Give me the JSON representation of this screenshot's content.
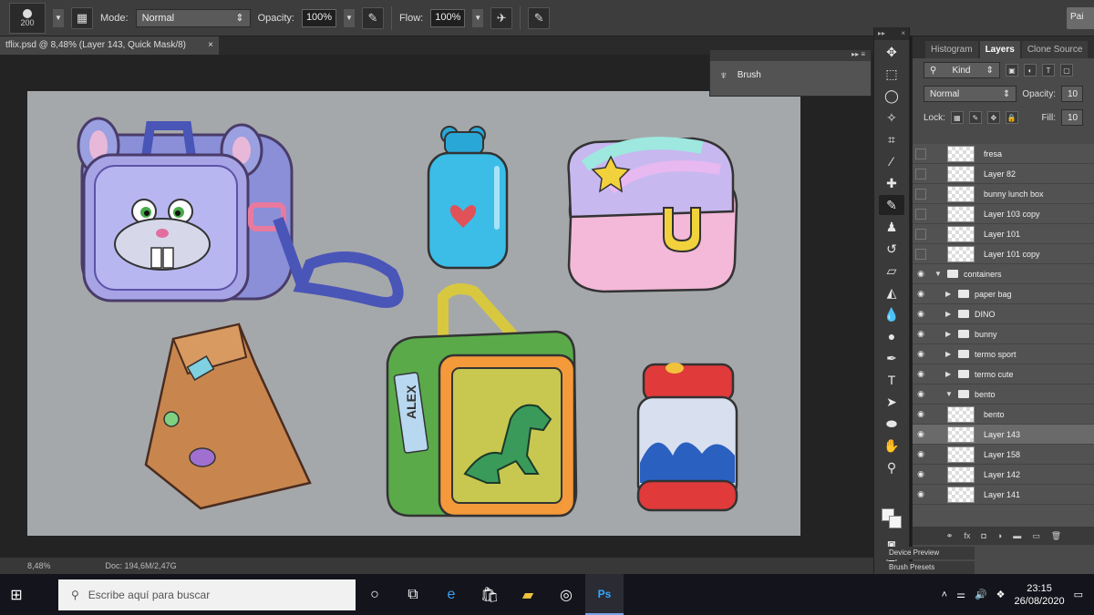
{
  "options_bar": {
    "brush_size": "200",
    "mode_label": "Mode:",
    "mode_value": "Normal",
    "opacity_label": "Opacity:",
    "opacity_value": "100%",
    "flow_label": "Flow:",
    "flow_value": "100%",
    "right_button": "Pai"
  },
  "document": {
    "tab_title": "tflix.psd @ 8,48% (Layer 143, Quick Mask/8)",
    "tab_close": "×",
    "zoom": "8,48%",
    "doc_size": "Doc: 194,6M/2,47G"
  },
  "canvas_art": {
    "lunchbox_name": "ALEX"
  },
  "brush_panel": {
    "label": "Brush"
  },
  "panels": {
    "tabs": [
      "Histogram",
      "Layers",
      "Clone Source"
    ],
    "active_tab": "Layers",
    "filter_kind": "Kind",
    "blend_mode": "Normal",
    "opacity_label": "Opacity:",
    "opacity_value": "10",
    "lock_label": "Lock:",
    "fill_label": "Fill:",
    "fill_value": "10",
    "layers": [
      {
        "name": "fresa",
        "type": "layer",
        "visible": false
      },
      {
        "name": "Layer 82",
        "type": "layer",
        "visible": false
      },
      {
        "name": "bunny lunch box",
        "type": "layer",
        "visible": false
      },
      {
        "name": "Layer 103 copy",
        "type": "layer",
        "visible": false
      },
      {
        "name": "Layer 101",
        "type": "layer",
        "visible": false
      },
      {
        "name": "Layer 101 copy",
        "type": "layer",
        "visible": false
      },
      {
        "name": "containers",
        "type": "group",
        "visible": true,
        "expanded": true
      },
      {
        "name": "paper bag",
        "type": "group",
        "visible": true
      },
      {
        "name": "DINO",
        "type": "group",
        "visible": true
      },
      {
        "name": "bunny",
        "type": "group",
        "visible": true
      },
      {
        "name": "termo sport",
        "type": "group",
        "visible": true
      },
      {
        "name": "termo cute",
        "type": "group",
        "visible": true
      },
      {
        "name": "bento",
        "type": "group",
        "visible": true,
        "expanded": true
      },
      {
        "name": "bento",
        "type": "layer",
        "visible": true
      },
      {
        "name": "Layer 143",
        "type": "layer",
        "visible": true,
        "selected": true
      },
      {
        "name": "Layer 158",
        "type": "layer",
        "visible": true
      },
      {
        "name": "Layer 142",
        "type": "layer",
        "visible": true
      },
      {
        "name": "Layer 141",
        "type": "layer",
        "visible": true
      }
    ],
    "bottom_tabs": [
      "Device Preview",
      "Brush Presets"
    ]
  },
  "taskbar": {
    "search_placeholder": "Escribe aquí para buscar",
    "time": "23:15",
    "date": "26/08/2020"
  },
  "colors": {
    "canvas_bg": "#a5a8aa",
    "ui_dark": "#3d3d3d",
    "taskbar": "#14151c"
  }
}
